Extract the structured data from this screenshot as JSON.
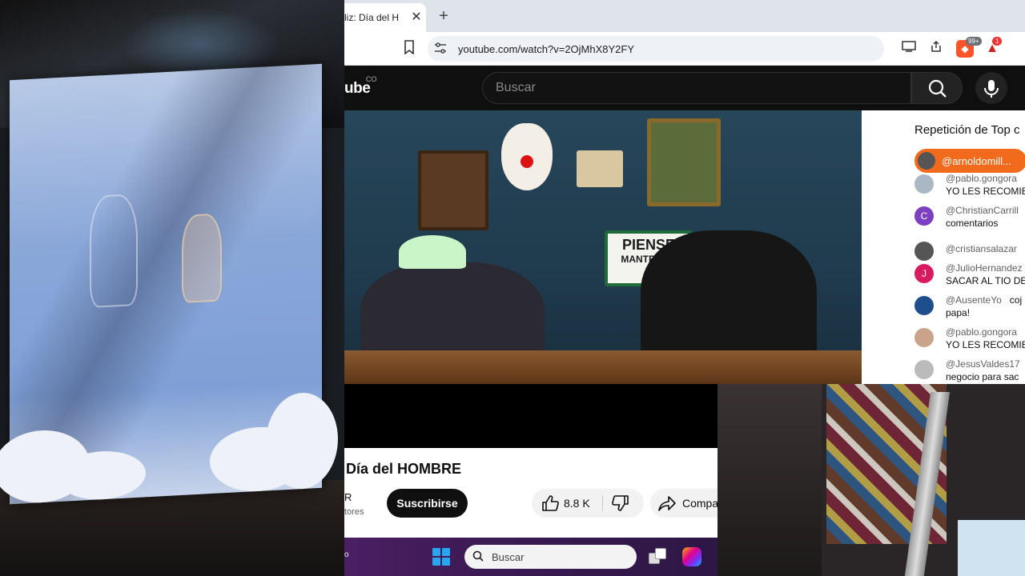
{
  "browser": {
    "tab_title": "liz: Día del H",
    "tab_close": "✕",
    "new_tab": "+",
    "url": "youtube.com/watch?v=2OjMhX8Y2FY",
    "brave_badge": "99+",
    "rewards_badge": "1"
  },
  "youtube": {
    "logo_fragment": "ube",
    "region": "CO",
    "search_placeholder": "Buscar"
  },
  "chat": {
    "title": "Repetición de Top c",
    "pinned_user": "@arnoldomill...",
    "messages": [
      {
        "user": "@pablo.gongora",
        "text": "YO LES RECOMIE",
        "initial": "",
        "color": "#a9b8c4"
      },
      {
        "user": "@ChristianCarrill",
        "text": "comentarios",
        "initial": "C",
        "color": "#7b3fbf"
      },
      {
        "user": "@cristiansalazar",
        "text": "",
        "initial": "",
        "color": "#555555"
      },
      {
        "user": "@JulioHernandez",
        "text": "SACAR AL TIO DE",
        "initial": "J",
        "color": "#d81b60"
      },
      {
        "user": "@AusenteYo",
        "text": "papa!",
        "extra": "coj",
        "initial": "",
        "color": "#1f4e8c"
      },
      {
        "user": "@pablo.gongora",
        "text": "YO LES RECOMIE",
        "initial": "",
        "color": "#c9a48a"
      },
      {
        "user": "@JesusValdes17",
        "text": "negocio para sac",
        "initial": "",
        "color": "#bbbbbb"
      }
    ]
  },
  "video_meta": {
    "title": "Día del HOMBRE",
    "channel_fragment": "R",
    "subs_fragment": "tores",
    "subscribe": "Suscribirse",
    "likes": "8.8 K",
    "share": "Compa"
  },
  "video_scene": {
    "sign_line1": "PIENSE",
    "sign_line2": "MANTENGA"
  },
  "taskbar": {
    "fragment": "o",
    "search_label": "Buscar"
  }
}
